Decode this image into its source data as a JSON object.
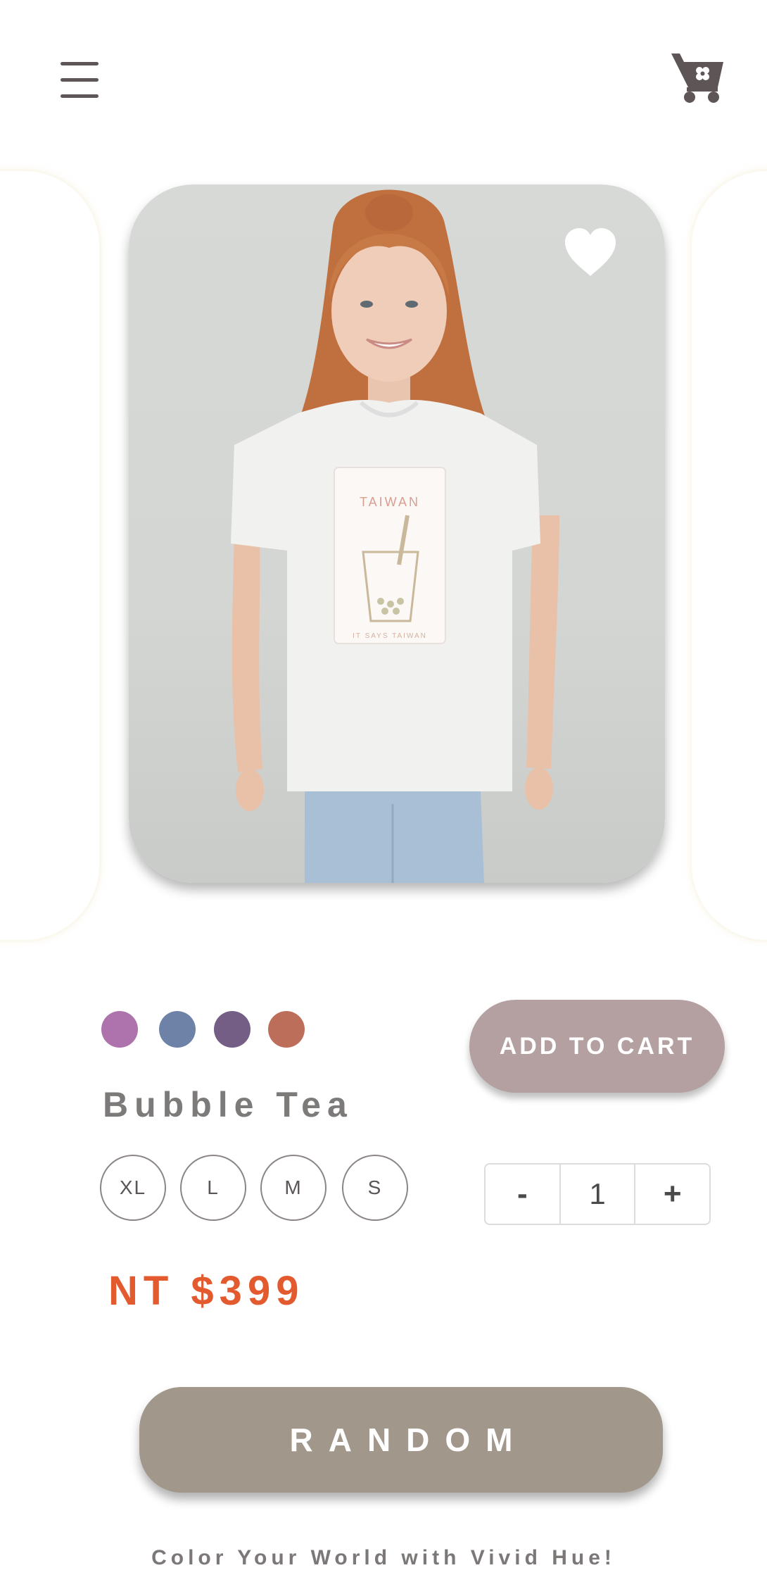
{
  "header": {
    "menu_icon": "hamburger-menu-icon",
    "cart_icon": "shopping-cart-icon"
  },
  "product": {
    "name": "Bubble Tea",
    "price": "NT $399",
    "favorite_icon": "heart-icon",
    "image": {
      "shirt_print_title": "TAIWAN",
      "shirt_print_footer": "IT SAYS TAIWAN"
    },
    "colors": [
      "#ae73ad",
      "#6e81a6",
      "#745e85",
      "#bd6e5b"
    ],
    "sizes": [
      "XL",
      "L",
      "M",
      "S"
    ],
    "quantity": {
      "minus_label": "-",
      "value": "1",
      "plus_label": "+"
    },
    "add_to_cart_label": "ADD TO CART"
  },
  "random_button_label": "RANDOM",
  "tagline": "Color Your World with Vivid Hue!",
  "colors": {
    "accent_price": "#e35a2f",
    "add_to_cart_bg": "#b4a0a1",
    "random_bg": "#a1978a"
  }
}
